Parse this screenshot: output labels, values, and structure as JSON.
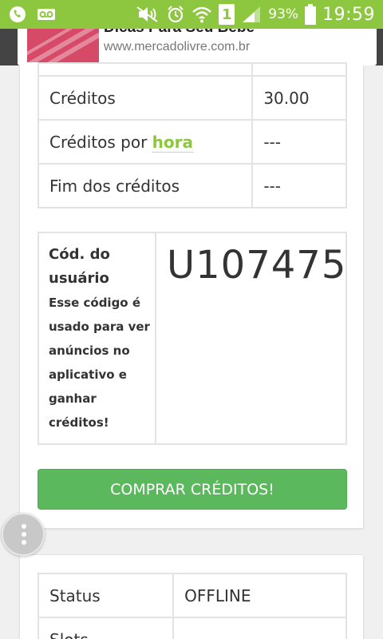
{
  "status_bar": {
    "left_icons": [
      "whatsapp-icon",
      "voicemail-icon"
    ],
    "right_icons": [
      "mute-icon",
      "alarm-icon",
      "wifi-icon",
      "sim-icon",
      "signal-icon",
      "battery-icon"
    ],
    "sim_number": "1",
    "battery": "93%",
    "time": "19:59",
    "bg_color": "#8dc63f"
  },
  "ad": {
    "title": "Dicas Para Seu Bebê",
    "url": "www.mercadolivre.com.br"
  },
  "credits_table": {
    "rows": [
      {
        "label": "Créditos",
        "value": "30.00"
      },
      {
        "label_prefix": "Créditos por ",
        "label_link": "hora",
        "value": "---"
      },
      {
        "label": "Fim dos créditos",
        "value": "---"
      }
    ]
  },
  "user_code": {
    "label": "Cód. do usuário",
    "description": "Esse código é usado para ver anúncios no aplicativo e ganhar créditos!",
    "value": "U107475"
  },
  "buy_button": {
    "label": "COMPRAR CRÉDITOS!",
    "color": "#5cb85c"
  },
  "status_table": {
    "rows": [
      {
        "label": "Status",
        "value": "OFFLINE"
      },
      {
        "label": "Slots",
        "value": ""
      }
    ]
  },
  "fab": {
    "icon": "more-vertical-icon"
  }
}
